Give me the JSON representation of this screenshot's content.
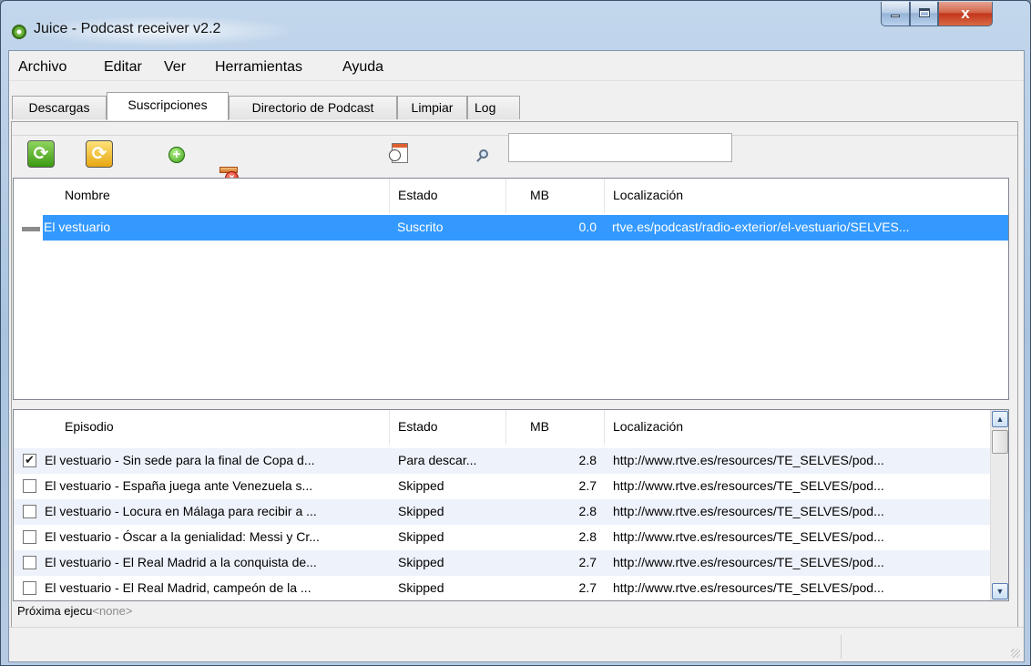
{
  "window": {
    "title": "Juice - Podcast receiver v2.2",
    "controls": {
      "minimize": "",
      "maximize": "",
      "close": "x"
    }
  },
  "menu": [
    "Archivo",
    "Editar",
    "Ver",
    "Herramientas",
    "Ayuda"
  ],
  "tabs": [
    {
      "label": "Descargas",
      "active": false
    },
    {
      "label": "Suscripciones",
      "active": true
    },
    {
      "label": "Directorio de Podcast",
      "active": false
    },
    {
      "label": "Limpiar",
      "active": false
    },
    {
      "label": "Log",
      "active": false
    }
  ],
  "toolbar": {
    "icons": [
      "refresh-all-icon",
      "scheduler-icon",
      "add-feed-icon",
      "delete-feed-icon",
      "feed-properties-icon",
      "feed-check-icon",
      "cleanup-icon",
      "search-icon"
    ],
    "search": {
      "value": "",
      "placeholder": ""
    }
  },
  "subscriptions": {
    "columns": [
      "Nombre",
      "Estado",
      "MB",
      "Localización"
    ],
    "rows": [
      {
        "nombre": "El vestuario",
        "estado": "Suscrito",
        "mb": "0.0",
        "localizacion": "rtve.es/podcast/radio-exterior/el-vestuario/SELVES...",
        "selected": true
      }
    ]
  },
  "episodes": {
    "columns": [
      "Episodio",
      "Estado",
      "MB",
      "Localización"
    ],
    "rows": [
      {
        "checked": true,
        "episodio": "El vestuario - Sin sede para la final de Copa d...",
        "estado": "Para descar...",
        "mb": "2.8",
        "localizacion": "http://www.rtve.es/resources/TE_SELVES/pod..."
      },
      {
        "checked": false,
        "episodio": "El vestuario - España juega ante Venezuela s...",
        "estado": "Skipped",
        "mb": "2.7",
        "localizacion": "http://www.rtve.es/resources/TE_SELVES/pod..."
      },
      {
        "checked": false,
        "episodio": "El vestuario - Locura en Málaga para recibir a ...",
        "estado": "Skipped",
        "mb": "2.8",
        "localizacion": "http://www.rtve.es/resources/TE_SELVES/pod..."
      },
      {
        "checked": false,
        "episodio": "El vestuario - Óscar a la genialidad: Messi y Cr...",
        "estado": "Skipped",
        "mb": "2.8",
        "localizacion": "http://www.rtve.es/resources/TE_SELVES/pod..."
      },
      {
        "checked": false,
        "episodio": "El vestuario - El Real Madrid a la conquista de...",
        "estado": "Skipped",
        "mb": "2.7",
        "localizacion": "http://www.rtve.es/resources/TE_SELVES/pod..."
      },
      {
        "checked": false,
        "episodio": "El vestuario - El Real Madrid, campeón de la ...",
        "estado": "Skipped",
        "mb": "2.7",
        "localizacion": "http://www.rtve.es/resources/TE_SELVES/pod..."
      }
    ]
  },
  "status": {
    "next_run_label": "Próxima ejecu",
    "next_run_value": "<none>"
  },
  "colors": {
    "selection": "#3399ff",
    "alt_row": "#eef2fb"
  }
}
